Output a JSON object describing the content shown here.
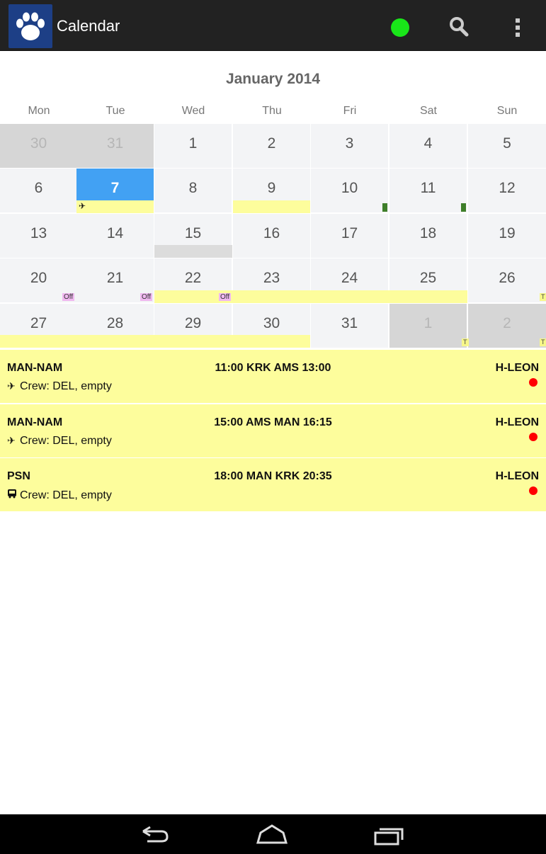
{
  "app_bar": {
    "title": "Calendar",
    "status_color": "#19e619",
    "icons": [
      "paw-icon",
      "search-icon",
      "overflow-menu-icon"
    ]
  },
  "calendar": {
    "month_title": "January 2014",
    "weekdays": [
      "Mon",
      "Tue",
      "Wed",
      "Thu",
      "Fri",
      "Sat",
      "Sun"
    ],
    "weeks": [
      [
        "30",
        "31",
        "1",
        "2",
        "3",
        "4",
        "5"
      ],
      [
        "6",
        "7",
        "8",
        "9",
        "10",
        "11",
        "12"
      ],
      [
        "13",
        "14",
        "15",
        "16",
        "17",
        "18",
        "19"
      ],
      [
        "20",
        "21",
        "22",
        "23",
        "24",
        "25",
        "26"
      ],
      [
        "27",
        "28",
        "29",
        "30",
        "31",
        "1",
        "2"
      ]
    ],
    "selected_day": "7",
    "off_label": "Off",
    "t_label": "T"
  },
  "flights": [
    {
      "code": "MAN-NAM",
      "route": "11:00 KRK AMS 13:00",
      "station": "H-LEON",
      "crew": "Crew: DEL, empty",
      "icon": "plane-icon"
    },
    {
      "code": "MAN-NAM",
      "route": "15:00 AMS MAN 16:15",
      "station": "H-LEON",
      "crew": "Crew: DEL, empty",
      "icon": "plane-icon"
    },
    {
      "code": "PSN",
      "route": "18:00 MAN KRK 20:35",
      "station": "H-LEON",
      "crew": "Crew: DEL, empty",
      "icon": "bus-icon"
    }
  ],
  "nav_bar": {
    "buttons": [
      "back-icon",
      "home-icon",
      "recent-apps-icon"
    ]
  }
}
